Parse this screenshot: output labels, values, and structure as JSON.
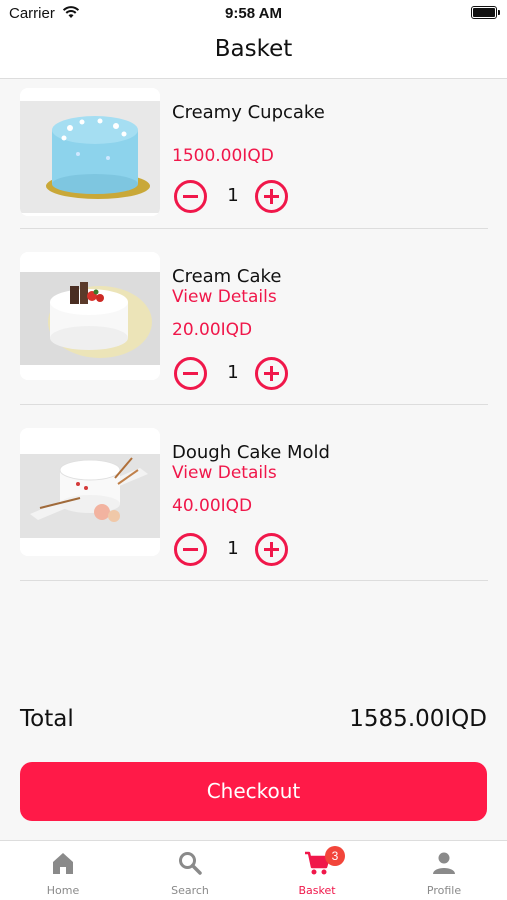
{
  "status_bar": {
    "carrier": "Carrier",
    "time": "9:58 AM"
  },
  "header": {
    "title": "Basket"
  },
  "items": [
    {
      "name": "Creamy Cupcake",
      "price": "1500.00IQD",
      "quantity": "1"
    },
    {
      "name": "Cream Cake",
      "link": "View Details",
      "price": "20.00IQD",
      "quantity": "1"
    },
    {
      "name": "Dough Cake Mold",
      "link": "View Details",
      "price": "40.00IQD",
      "quantity": "1"
    }
  ],
  "summary": {
    "total_label": "Total",
    "total_value": "1585.00IQD"
  },
  "checkout": {
    "label": "Checkout"
  },
  "tabbar": {
    "tabs": [
      {
        "label": "Home",
        "icon": "home-icon"
      },
      {
        "label": "Search",
        "icon": "search-icon"
      },
      {
        "label": "Basket",
        "icon": "cart-icon",
        "badge": "3"
      },
      {
        "label": "Profile",
        "icon": "person-icon"
      }
    ],
    "active_tab": "Basket"
  },
  "colors": {
    "accent": "#f0174a",
    "checkout": "#ff1a48",
    "badge": "#f2453a",
    "inactive": "#8a8a8a"
  }
}
